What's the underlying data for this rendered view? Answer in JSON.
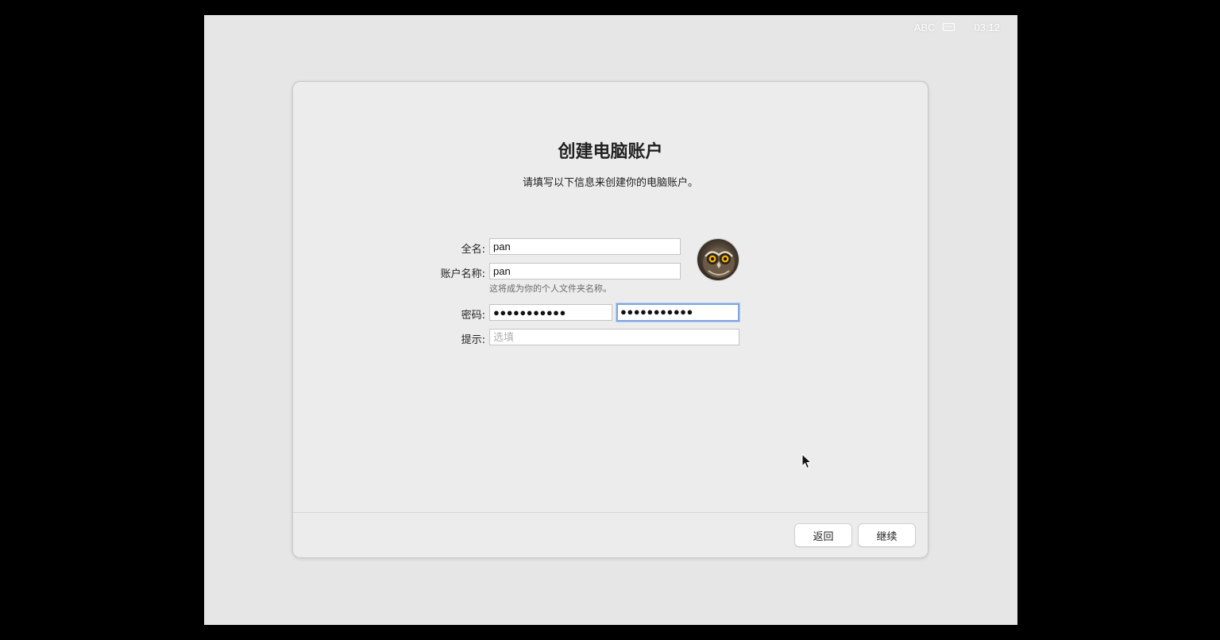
{
  "status_bar": {
    "input_method": "ABC",
    "input_icon": "keyboard-icon",
    "time": "03:12"
  },
  "dialog": {
    "title": "创建电脑账户",
    "subtitle": "请填写以下信息来创建你的电脑账户。"
  },
  "form": {
    "full_name_label": "全名:",
    "full_name_value": "pan",
    "account_name_label": "账户名称:",
    "account_name_value": "pan",
    "account_name_note": "这将成为你的个人文件夹名称。",
    "password_label": "密码:",
    "password_value": "●●●●●●●●●●●",
    "verify_value": "●●●●●●●●●●●",
    "hint_label": "提示:",
    "hint_placeholder": "选填",
    "avatar_icon": "owl-avatar"
  },
  "buttons": {
    "back_label": "返回",
    "continue_label": "继续"
  },
  "colors": {
    "background": "#e6e6e6",
    "window": "#ececec",
    "focus_ring": "#7fa7de"
  }
}
